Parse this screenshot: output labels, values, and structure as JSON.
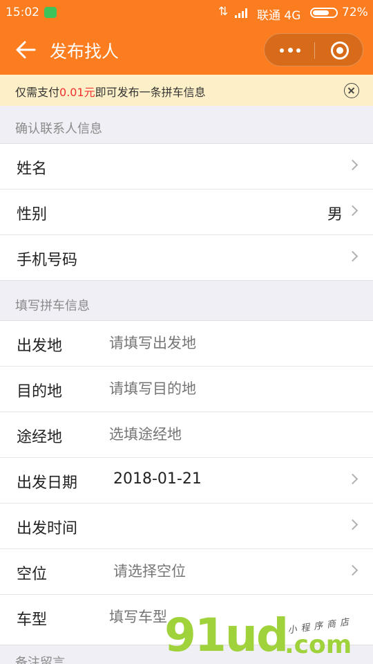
{
  "status_bar": {
    "time": "15:02",
    "network_arrows": "⇅",
    "carrier": "联通 4G",
    "battery_percent": "72%",
    "battery_level": 0.72
  },
  "nav": {
    "title": "发布找人"
  },
  "notice": {
    "prefix": "仅需支付",
    "amount": "0.01元",
    "suffix": "即可发布一条拼车信息"
  },
  "contact_section": {
    "title": "确认联系人信息",
    "rows": [
      {
        "label": "姓名",
        "value": ""
      },
      {
        "label": "性别",
        "value": "男"
      },
      {
        "label": "手机号码",
        "value": ""
      }
    ]
  },
  "trip_section": {
    "title": "填写拼车信息",
    "departure": {
      "label": "出发地",
      "placeholder": "请填写出发地"
    },
    "destination": {
      "label": "目的地",
      "placeholder": "请填写目的地"
    },
    "waypoint": {
      "label": "途经地",
      "placeholder": "选填途经地"
    },
    "date": {
      "label": "出发日期",
      "value": "2018-01-21"
    },
    "time": {
      "label": "出发时间",
      "value": ""
    },
    "seats": {
      "label": "空位",
      "placeholder": "请选择空位"
    },
    "car_type": {
      "label": "车型",
      "placeholder": "填写车型"
    }
  },
  "remarks_section": {
    "title": "备注留言"
  },
  "watermark": {
    "main": "91ud",
    "domain": ".com",
    "tagline": "小程序商店"
  },
  "colors": {
    "brand": "#fb7d1f",
    "notice_bg": "#fdf0c8",
    "amount": "#f23030",
    "watermark": "#9fd23b"
  }
}
